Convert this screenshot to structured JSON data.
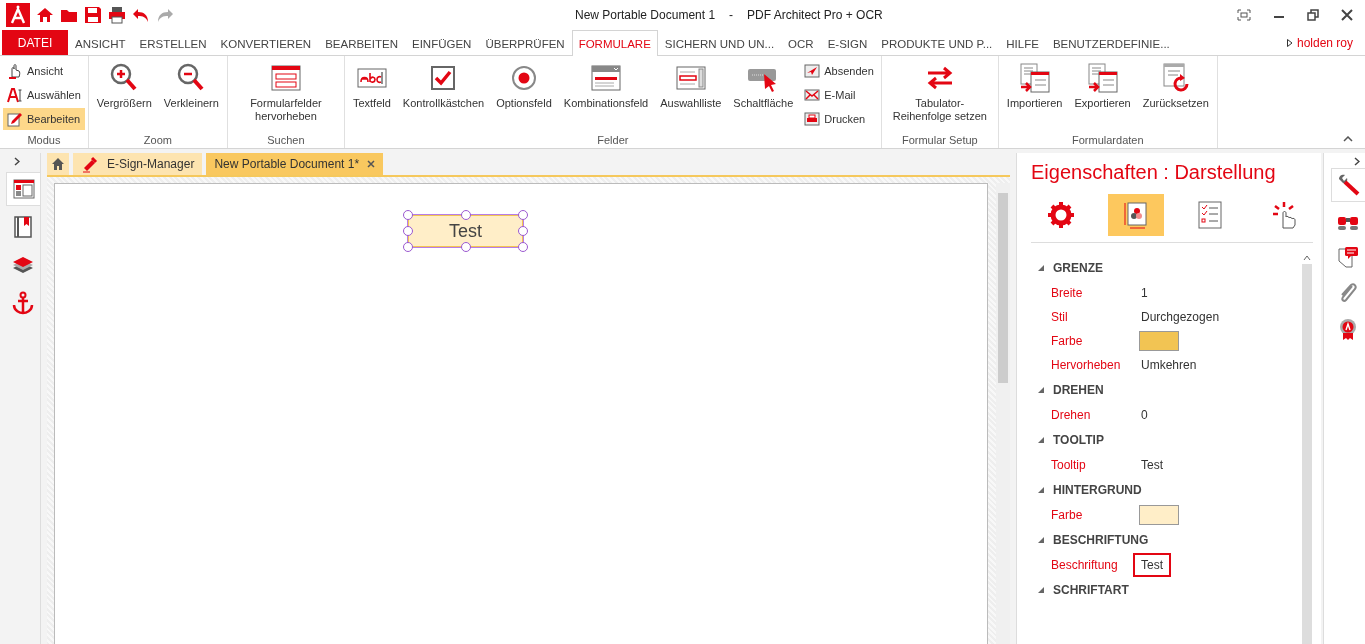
{
  "window": {
    "document": "New Portable Document 1",
    "separator": "-",
    "app": "PDF Architect Pro + OCR"
  },
  "menu": [
    {
      "label": "DATEI",
      "kind": "file",
      "selected": false
    },
    {
      "label": "ANSICHT",
      "kind": "tab",
      "selected": false
    },
    {
      "label": "ERSTELLEN",
      "kind": "tab",
      "selected": false
    },
    {
      "label": "KONVERTIEREN",
      "kind": "tab",
      "selected": false
    },
    {
      "label": "BEARBEITEN",
      "kind": "tab",
      "selected": false
    },
    {
      "label": "EINFÜGEN",
      "kind": "tab",
      "selected": false
    },
    {
      "label": "ÜBERPRÜFEN",
      "kind": "tab",
      "selected": false
    },
    {
      "label": "FORMULARE",
      "kind": "tab",
      "selected": true
    },
    {
      "label": "SICHERN UND UN...",
      "kind": "tab",
      "selected": false
    },
    {
      "label": "OCR",
      "kind": "tab",
      "selected": false
    },
    {
      "label": "E-SIGN",
      "kind": "tab",
      "selected": false
    },
    {
      "label": "PRODUKTE UND P...",
      "kind": "tab",
      "selected": false
    },
    {
      "label": "HILFE",
      "kind": "tab",
      "selected": false
    },
    {
      "label": "BENUTZERDEFINIE...",
      "kind": "tab",
      "selected": false
    }
  ],
  "user": "holden roy",
  "ribbon": [
    {
      "label": "Modus",
      "tools": [
        {
          "label": "Ansicht",
          "kind": "small",
          "selected": false
        },
        {
          "label": "Auswählen",
          "kind": "small",
          "selected": false
        },
        {
          "label": "Bearbeiten",
          "kind": "small",
          "selected": true
        }
      ]
    },
    {
      "label": "Zoom",
      "tools": [
        {
          "label": "Vergrößern",
          "kind": "large"
        },
        {
          "label": "Verkleinern",
          "kind": "large"
        }
      ]
    },
    {
      "label": "Suchen",
      "tools": [
        {
          "label": "Formularfelder hervorheben",
          "kind": "large"
        }
      ]
    },
    {
      "label": "Felder",
      "tools": [
        {
          "label": "Textfeld",
          "kind": "large"
        },
        {
          "label": "Kontrollkästchen",
          "kind": "large"
        },
        {
          "label": "Optionsfeld",
          "kind": "large"
        },
        {
          "label": "Kombinationsfeld",
          "kind": "large"
        },
        {
          "label": "Auswahlliste",
          "kind": "large"
        },
        {
          "label": "Schaltfläche",
          "kind": "large"
        },
        {
          "label": "Absenden",
          "kind": "small",
          "selected": false
        },
        {
          "label": "E-Mail",
          "kind": "small",
          "selected": false
        },
        {
          "label": "Drucken",
          "kind": "small",
          "selected": false
        }
      ]
    },
    {
      "label": "Formular Setup",
      "tools": [
        {
          "label": "Tabulator-Reihenfolge setzen",
          "kind": "large"
        }
      ]
    },
    {
      "label": "Formulardaten",
      "tools": [
        {
          "label": "Importieren",
          "kind": "large"
        },
        {
          "label": "Exportieren",
          "kind": "large"
        },
        {
          "label": "Zurücksetzen",
          "kind": "large"
        }
      ]
    }
  ],
  "left_panel": [
    {
      "selected": true
    },
    {
      "selected": false
    },
    {
      "selected": false
    },
    {
      "selected": false
    }
  ],
  "doc_tabs": [
    {
      "label": "E-Sign-Manager",
      "selected": false
    },
    {
      "label": "New Portable Document 1*",
      "selected": true
    }
  ],
  "form_field": {
    "caption": "Test",
    "selected": true
  },
  "properties": {
    "title": "Eigenschaften : Darstellung",
    "tabs": [
      {
        "selected": false
      },
      {
        "selected": true
      },
      {
        "selected": false
      },
      {
        "selected": false
      }
    ],
    "sections": [
      {
        "title": "GRENZE",
        "expanded": true,
        "rows": [
          {
            "label": "Breite",
            "kind": "text",
            "value": "1"
          },
          {
            "label": "Stil",
            "kind": "text",
            "value": "Durchgezogen"
          },
          {
            "label": "Farbe",
            "kind": "color",
            "color": "#f2c453"
          },
          {
            "label": "Hervorheben",
            "kind": "text",
            "value": "Umkehren"
          }
        ]
      },
      {
        "title": "DREHEN",
        "expanded": true,
        "rows": [
          {
            "label": "Drehen",
            "kind": "text",
            "value": "0"
          }
        ]
      },
      {
        "title": "TOOLTIP",
        "expanded": true,
        "rows": [
          {
            "label": "Tooltip",
            "kind": "text",
            "value": "Test"
          }
        ]
      },
      {
        "title": "HINTERGRUND",
        "expanded": true,
        "rows": [
          {
            "label": "Farbe",
            "kind": "color",
            "color": "#ffeec8"
          }
        ]
      },
      {
        "title": "BESCHRIFTUNG",
        "expanded": true,
        "rows": [
          {
            "label": "Beschriftung",
            "kind": "text",
            "value": "Test",
            "highlighted": true
          }
        ]
      },
      {
        "title": "SCHRIFTART",
        "expanded": true
      }
    ]
  },
  "right_panel": [
    {
      "selected": true
    },
    {
      "selected": false
    },
    {
      "selected": false
    },
    {
      "selected": false
    },
    {
      "selected": false
    }
  ]
}
